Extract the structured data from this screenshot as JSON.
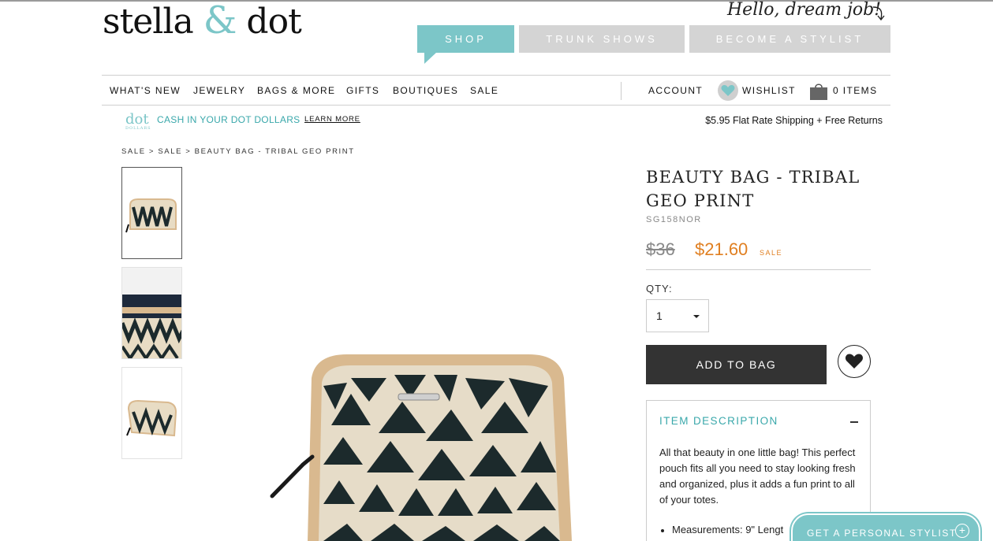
{
  "brand": {
    "logo_part1": "stella",
    "logo_amp": "&",
    "logo_part2": "dot",
    "tagline": "Hello, dream job!"
  },
  "top_tabs": [
    {
      "label": "SHOP",
      "active": true
    },
    {
      "label": "TRUNK SHOWS",
      "active": false
    },
    {
      "label": "BECOME A STYLIST",
      "active": false
    }
  ],
  "nav": {
    "items": [
      "WHAT'S NEW",
      "JEWELRY",
      "BAGS & MORE",
      "GIFTS",
      "BOUTIQUES",
      "SALE"
    ],
    "account": "ACCOUNT",
    "wishlist": "WISHLIST",
    "cart": "0 ITEMS"
  },
  "promo": {
    "dot_logo": "dot",
    "dot_logo_sub": "DOLLARS",
    "cash_text": "CASH IN YOUR DOT DOLLARS",
    "learn_more": "LEARN MORE",
    "shipping": "$5.95 Flat Rate Shipping + Free Returns"
  },
  "breadcrumb": "SALE > SALE > BEAUTY BAG - TRIBAL GEO PRINT",
  "product": {
    "title": "BEAUTY BAG - TRIBAL GEO PRINT",
    "sku": "SG158NOR",
    "price_original": "$36",
    "price_sale": "$21.60",
    "sale_label": "SALE",
    "qty_label": "QTY:",
    "qty_value": "1",
    "add_to_bag": "ADD TO BAG",
    "description_heading": "ITEM DESCRIPTION",
    "description_text": "All that beauty in one little bag! This perfect pouch fits all you need to stay looking fresh and organized, plus it adds a fun print to all of your totes.",
    "bullet_1": "Measurements: 9\" Lengt"
  },
  "stylist_cta": "GET A PERSONAL STYLIST",
  "colors": {
    "accent": "#7cc6c8",
    "sale": "#e07f21",
    "button_dark": "#333333",
    "tab_inactive": "#d4d4d4"
  }
}
